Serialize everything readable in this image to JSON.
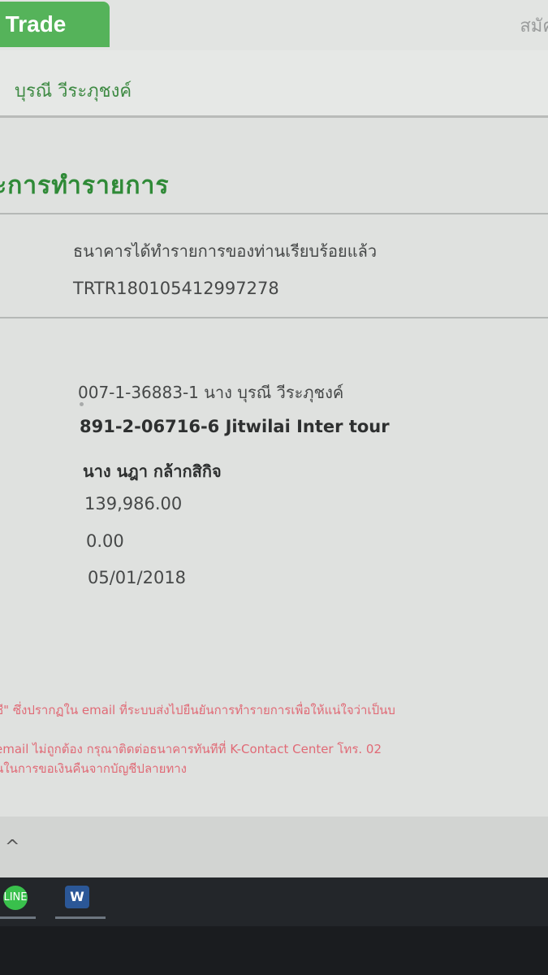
{
  "header": {
    "trade_tab": "r Trade",
    "register_link": "สมัค"
  },
  "user": {
    "name": "บุรณี วีระภุชงค์"
  },
  "page": {
    "title": "ะการทำรายการ"
  },
  "result": {
    "message": "ธนาคารได้ทำรายการของท่านเรียบร้อยแล้ว",
    "reference": "TRTR180105412997278"
  },
  "transfer": {
    "from_account": "007-1-36883-1 นาง บุรณี วีระภุชงค์",
    "to_account": "891-2-06716-6 Jitwilai Inter tour",
    "to_name": "นาง นฎา กล้ากสิกิจ",
    "amount": "139,986.00",
    "fee": "0.00",
    "date": "05/01/2018"
  },
  "notes": {
    "line1": "ชี\" ซึ่งปรากฏใน email ที่ระบบส่งไปยืนยันการทำรายการเพื่อให้แน่ใจว่าเป็นบ",
    "line2": "email ไม่ถูกต้อง กรุณาติดต่อธนาคารทันทีที่ K-Contact Center โทร. 02",
    "line3": "นในการขอเงินคืนจากบัญชีปลายทาง"
  },
  "taskbar": {
    "line_label": "LINE",
    "word_label": "W"
  },
  "colors": {
    "accent_green": "#55b35a",
    "title_green": "#2f8a37",
    "note_red": "#e06a76"
  }
}
